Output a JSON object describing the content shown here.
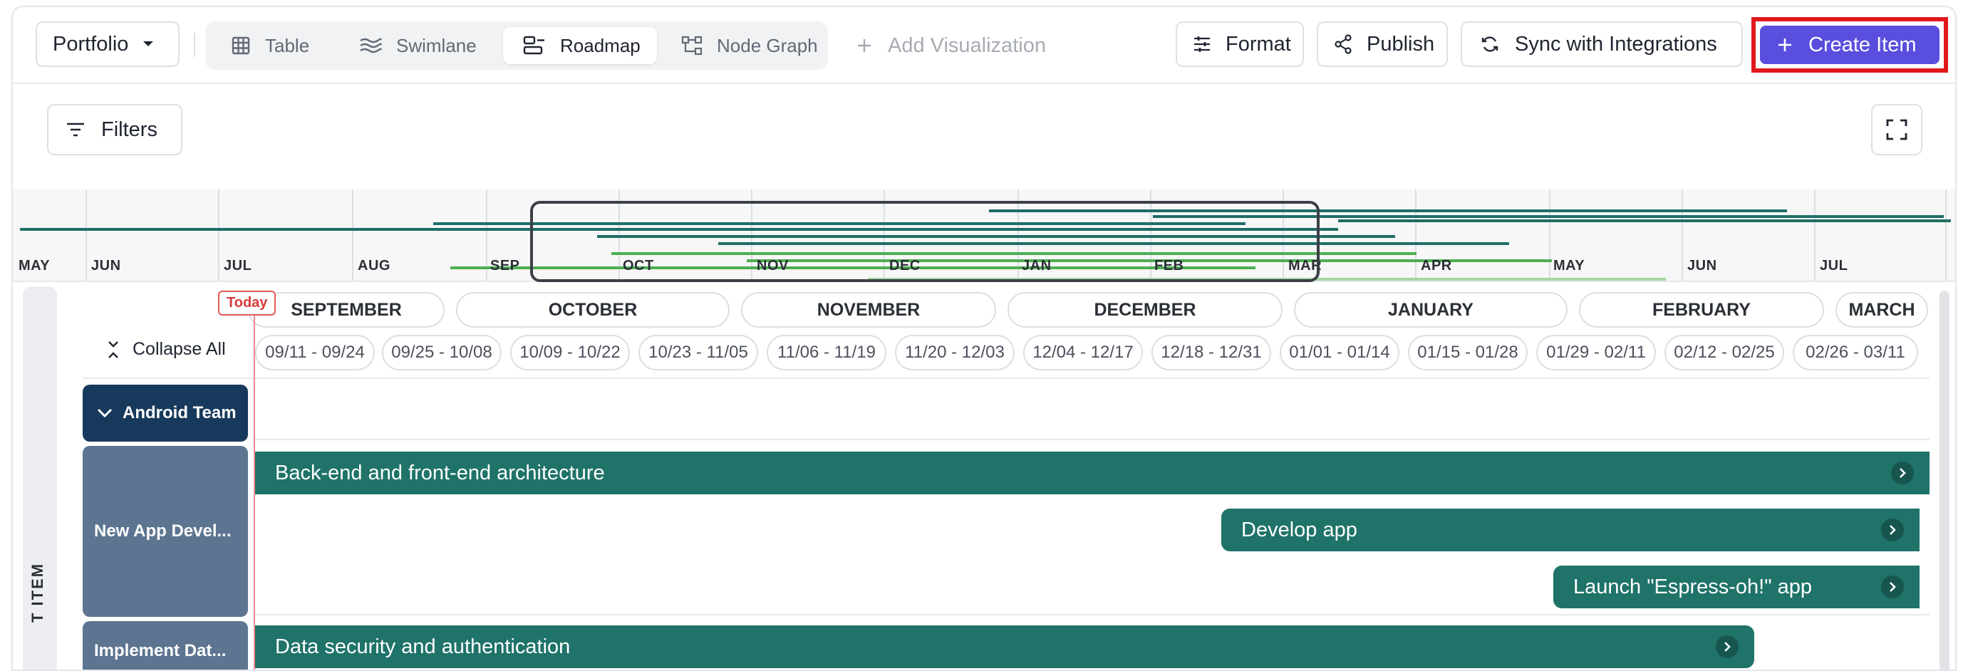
{
  "toolbar": {
    "portfolio_label": "Portfolio",
    "views": [
      {
        "label": "Table",
        "icon": "table-icon"
      },
      {
        "label": "Swimlane",
        "icon": "swimlane-icon"
      },
      {
        "label": "Roadmap",
        "icon": "roadmap-icon",
        "active": true
      },
      {
        "label": "Node Graph",
        "icon": "node-graph-icon"
      }
    ],
    "add_visualization": "Add Visualization",
    "format_label": "Format",
    "publish_label": "Publish",
    "sync_label": "Sync with Integrations",
    "create_label": "Create Item"
  },
  "filters": {
    "label": "Filters"
  },
  "minimap": {
    "months": [
      "MAY",
      "JUN",
      "JUL",
      "AUG",
      "SEP",
      "OCT",
      "NOV",
      "DEC",
      "JAN",
      "FEB",
      "MAR",
      "APR",
      "MAY",
      "JUN",
      "JUL"
    ]
  },
  "timeline": {
    "today_label": "Today",
    "collapse_label": "Collapse All",
    "side_label": "T ITEM",
    "months": [
      "SEPTEMBER",
      "OCTOBER",
      "NOVEMBER",
      "DECEMBER",
      "JANUARY",
      "FEBRUARY",
      "MARCH"
    ],
    "weeks": [
      "09/11 - 09/24",
      "09/25 - 10/08",
      "10/09 - 10/22",
      "10/23 - 11/05",
      "11/06 - 11/19",
      "11/20 - 12/03",
      "12/04 - 12/17",
      "12/18 - 12/31",
      "01/01 - 01/14",
      "01/15 - 01/28",
      "01/29 - 02/11",
      "02/12 - 02/25",
      "02/26 - 03/11"
    ]
  },
  "groups": [
    {
      "name": "Android Team",
      "lanes": [
        {
          "name": "New App Devel...",
          "items": [
            "Back-end and front-end architecture",
            "Develop app",
            "Launch \"Espress-oh!\" app"
          ]
        },
        {
          "name": "Implement Dat...",
          "items": [
            "Data security and authentication"
          ]
        }
      ]
    }
  ],
  "colors": {
    "accent": "#5a4ede",
    "bar": "#1f7369",
    "group": "#173a5c",
    "lane": "#5d7590",
    "today": "#e25757",
    "highlight": "#e0181b"
  }
}
